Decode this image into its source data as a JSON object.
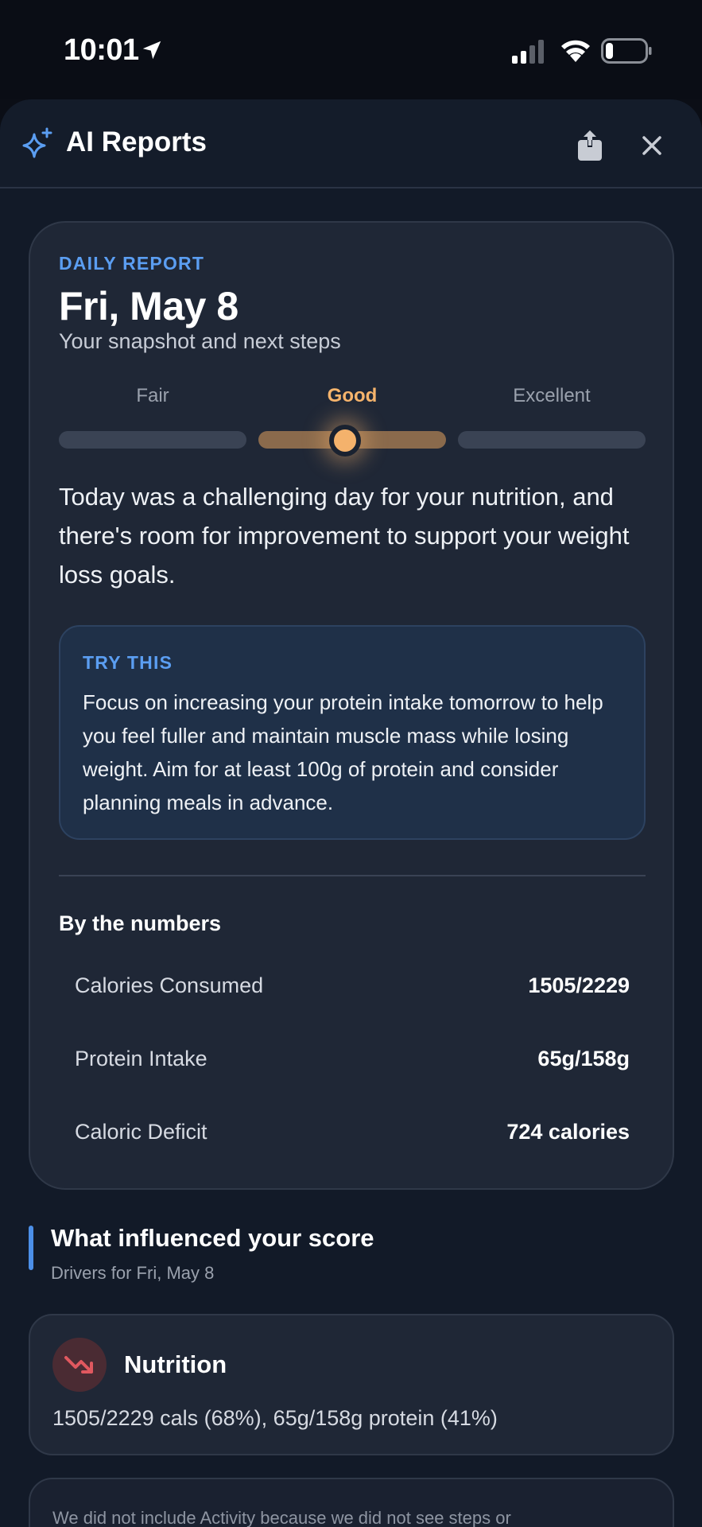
{
  "status_bar": {
    "time": "10:01"
  },
  "header": {
    "title": "AI Reports",
    "icons": [
      "sparkle-icon",
      "share-icon",
      "close-icon"
    ],
    "accent_color": "#5b9ef2"
  },
  "report": {
    "eyebrow": "DAILY REPORT",
    "date": "Fri, May 8",
    "subtitle": "Your snapshot and next steps",
    "rating": {
      "options": [
        "Fair",
        "Good",
        "Excellent"
      ],
      "selected": "Good",
      "selected_color": "#f6b46c"
    },
    "summary": "Today was a challenging day for your nutrition, and there's room for improvement to support your weight loss goals.",
    "tip": {
      "label": "TRY THIS",
      "body": "Focus on increasing your protein intake tomorrow to help you feel fuller and maintain muscle mass while losing weight. Aim for at least 100g of protein and consider planning meals in advance."
    },
    "numbers": {
      "title": "By the numbers",
      "rows": [
        {
          "label": "Calories Consumed",
          "value": "1505/2229"
        },
        {
          "label": "Protein Intake",
          "value": "65g/158g"
        },
        {
          "label": "Caloric Deficit",
          "value": "724 calories"
        }
      ]
    }
  },
  "influence": {
    "title": "What influenced your score",
    "subtitle": "Drivers for Fri, May 8",
    "nutrition": {
      "title": "Nutrition",
      "detail": "1505/2229 cals (68%), 65g/158g protein (41%)",
      "trend_icon": "trending-down-icon",
      "trend_color": "#e0585f"
    },
    "note": "We did not include Activity because we did not see steps or"
  }
}
